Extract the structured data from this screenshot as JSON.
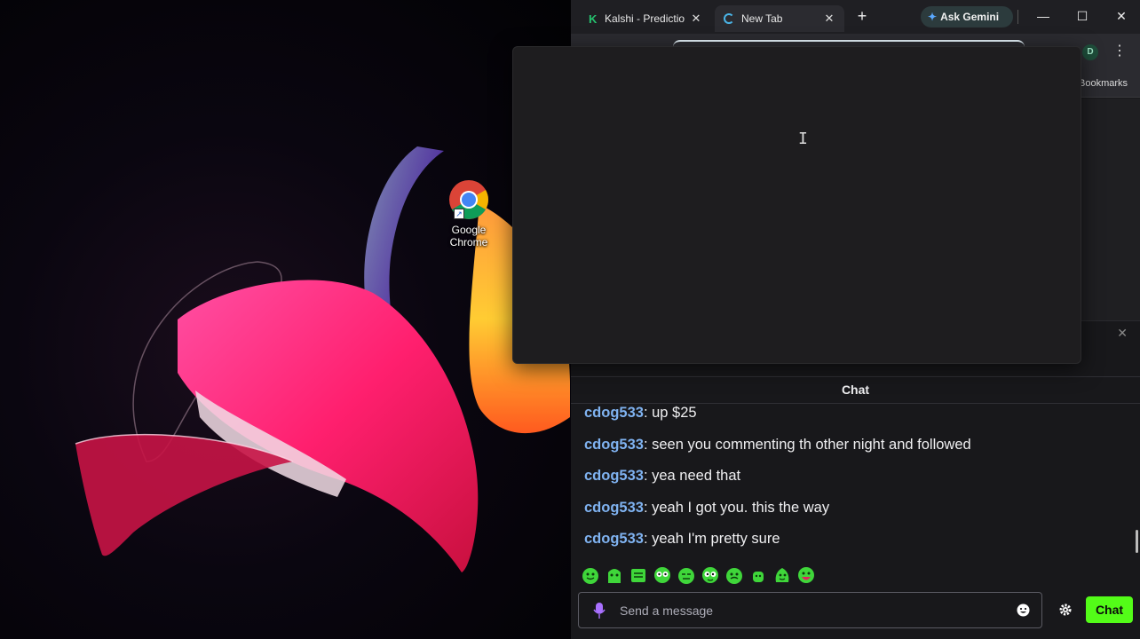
{
  "desktop": {
    "icons": [
      {
        "label": "Google Chrome",
        "icon": "chrome-icon"
      }
    ]
  },
  "browser": {
    "tabs": [
      {
        "title": "Kalshi - Predictio",
        "favicon": "K",
        "active": false
      },
      {
        "title": "New Tab",
        "favicon": "loading-spinner",
        "active": true
      }
    ],
    "new_tab_symbol": "+",
    "gemini_label": "Ask Gemini",
    "window_controls": {
      "minimize": "—",
      "maximize": "☐",
      "close": "✕"
    },
    "profile_initial": "D",
    "menu_symbol": "⋮",
    "bookmarks_label": "Bookmarks",
    "strip_close": "✕"
  },
  "chat": {
    "header": "Chat",
    "messages": [
      {
        "user": "cdog533",
        "text": ": up $25"
      },
      {
        "user": "cdog533",
        "text": ": seen you commenting th other night and followed"
      },
      {
        "user": "cdog533",
        "text": ": yea need that"
      },
      {
        "user": "cdog533",
        "text": ": yeah I got you. this the way"
      },
      {
        "user": "cdog533",
        "text": ": yeah I'm pretty sure"
      }
    ],
    "emote_count": 10,
    "input_placeholder": "Send a message",
    "send_label": "Chat",
    "accent_color": "#53fc18",
    "username_color": "#7fb2f0"
  },
  "omnibox": {
    "cursor": "I"
  }
}
